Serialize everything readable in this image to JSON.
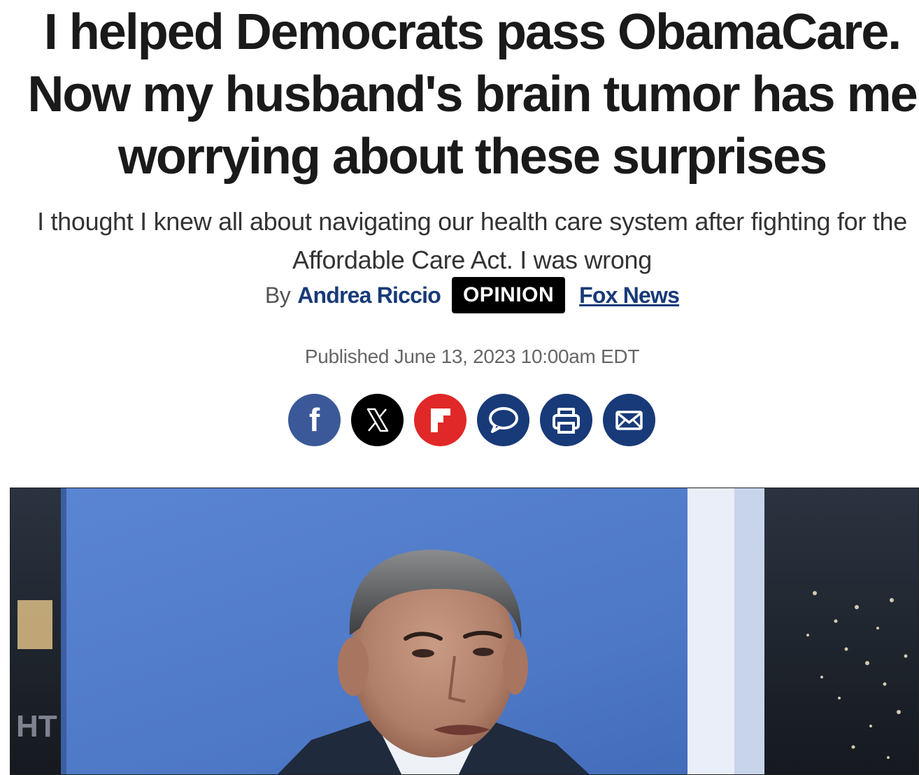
{
  "article": {
    "headline": "I helped Democrats pass ObamaCare. Now my husband's brain tumor has me worrying about these surprises",
    "subhead": "I thought I knew all about navigating our health care system after fighting for the Affordable Care Act. I was wrong",
    "byline": {
      "by_label": "By",
      "author": "Andrea Riccio",
      "badge": "OPINION",
      "outlet": "Fox News"
    },
    "published": "Published June 13, 2023 10:00am EDT"
  },
  "share": {
    "buttons": [
      {
        "icon": "facebook-icon",
        "color": "#3b5998"
      },
      {
        "icon": "x-icon",
        "color": "#000000"
      },
      {
        "icon": "flipboard-icon",
        "color": "#e12828"
      },
      {
        "icon": "comment-icon",
        "color": "#183a78"
      },
      {
        "icon": "print-icon",
        "color": "#183a78"
      },
      {
        "icon": "email-icon",
        "color": "#183a78"
      }
    ]
  },
  "hero": {
    "watermark": "HT",
    "background": "#4f7ac9"
  }
}
